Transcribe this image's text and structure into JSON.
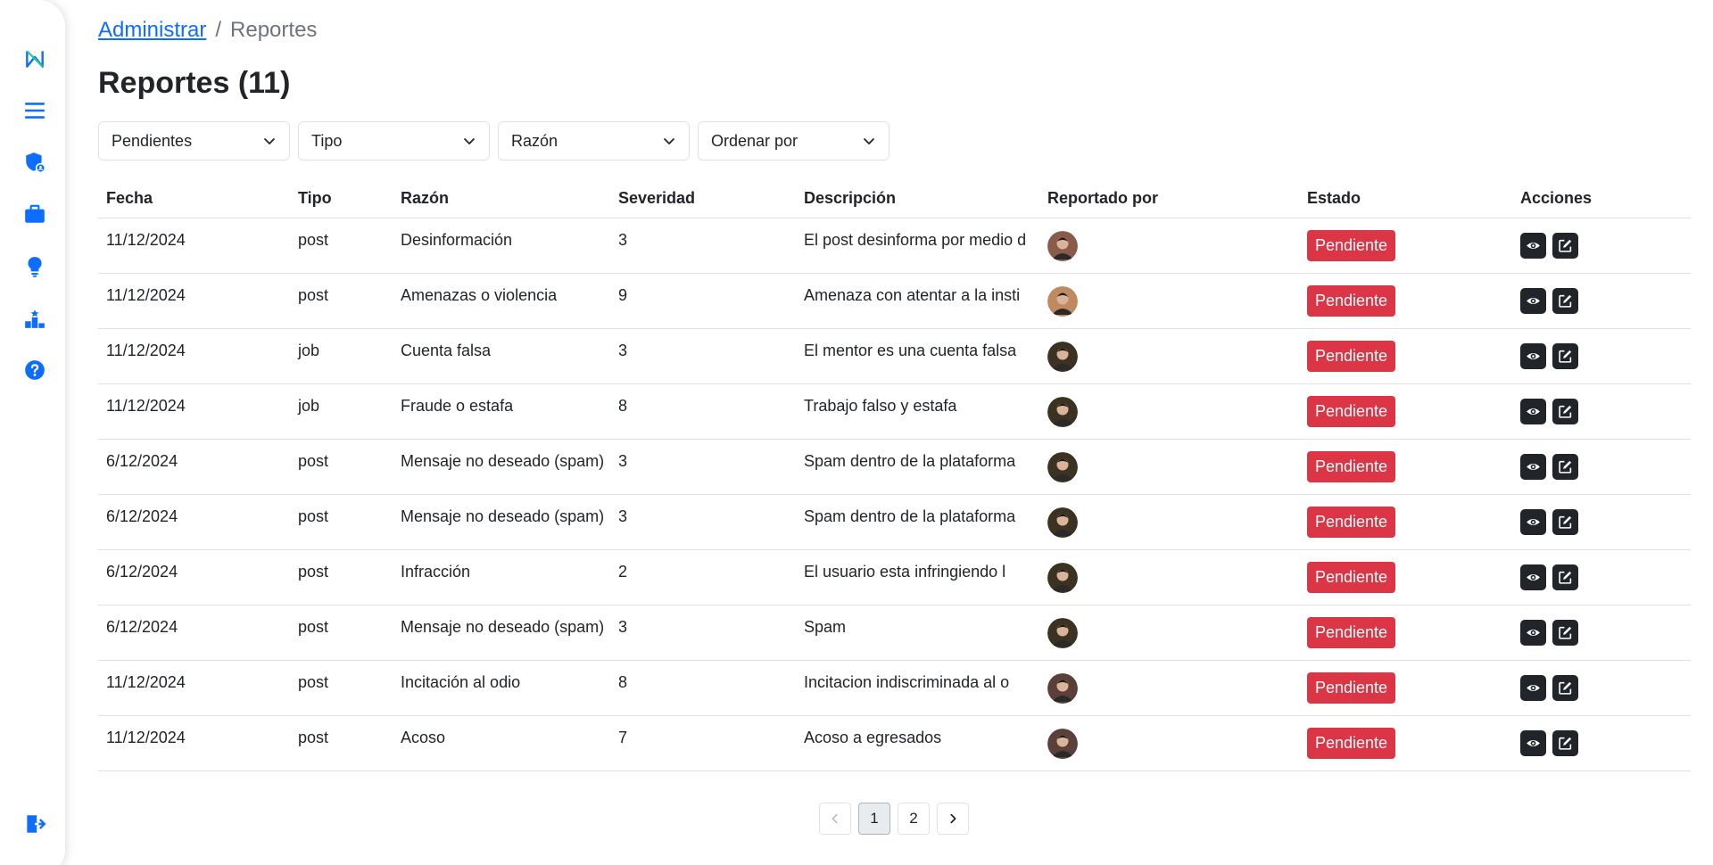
{
  "breadcrumb": {
    "parent": "Administrar",
    "separator": "/",
    "current": "Reportes"
  },
  "page_title": "Reportes (11)",
  "filters": [
    {
      "label": "Pendientes"
    },
    {
      "label": "Tipo"
    },
    {
      "label": "Razón"
    },
    {
      "label": "Ordenar por"
    }
  ],
  "table": {
    "headers": [
      "Fecha",
      "Tipo",
      "Razón",
      "Severidad",
      "Descripción",
      "Reportado por",
      "Estado",
      "Acciones"
    ],
    "rows": [
      {
        "fecha": "11/12/2024",
        "tipo": "post",
        "razon": "Desinformación",
        "severidad": "3",
        "descripcion": "El post desinforma por medio d",
        "estado": "Pendiente",
        "avatar_color": "#8a5a4a"
      },
      {
        "fecha": "11/12/2024",
        "tipo": "post",
        "razon": "Amenazas o violencia",
        "severidad": "9",
        "descripcion": "Amenaza con atentar a la insti",
        "estado": "Pendiente",
        "avatar_color": "#c08a60"
      },
      {
        "fecha": "11/12/2024",
        "tipo": "job",
        "razon": "Cuenta falsa",
        "severidad": "3",
        "descripcion": "El mentor es una cuenta falsa",
        "estado": "Pendiente",
        "avatar_color": "#3b3222"
      },
      {
        "fecha": "11/12/2024",
        "tipo": "job",
        "razon": "Fraude o estafa",
        "severidad": "8",
        "descripcion": "Trabajo falso y estafa",
        "estado": "Pendiente",
        "avatar_color": "#3b3222"
      },
      {
        "fecha": "6/12/2024",
        "tipo": "post",
        "razon": "Mensaje no deseado (spam)",
        "severidad": "3",
        "descripcion": "Spam dentro de la plataforma",
        "estado": "Pendiente",
        "avatar_color": "#3b3222"
      },
      {
        "fecha": "6/12/2024",
        "tipo": "post",
        "razon": "Mensaje no deseado (spam)",
        "severidad": "3",
        "descripcion": "Spam dentro de la plataforma",
        "estado": "Pendiente",
        "avatar_color": "#3b3222"
      },
      {
        "fecha": "6/12/2024",
        "tipo": "post",
        "razon": "Infracción",
        "severidad": "2",
        "descripcion": "El usuario esta infringiendo l",
        "estado": "Pendiente",
        "avatar_color": "#3b3222"
      },
      {
        "fecha": "6/12/2024",
        "tipo": "post",
        "razon": "Mensaje no deseado (spam)",
        "severidad": "3",
        "descripcion": "Spam",
        "estado": "Pendiente",
        "avatar_color": "#3b3222"
      },
      {
        "fecha": "11/12/2024",
        "tipo": "post",
        "razon": "Incitación al odio",
        "severidad": "8",
        "descripcion": "Incitacion indiscriminada al o",
        "estado": "Pendiente",
        "avatar_color": "#5a4038"
      },
      {
        "fecha": "11/12/2024",
        "tipo": "post",
        "razon": "Acoso",
        "severidad": "7",
        "descripcion": "Acoso a egresados",
        "estado": "Pendiente",
        "avatar_color": "#5a4038"
      }
    ]
  },
  "pagination": {
    "pages": [
      "1",
      "2"
    ],
    "current": "1"
  },
  "sidebar": {
    "icons": [
      "logo-icon",
      "menu-icon",
      "shield-user-icon",
      "briefcase-icon",
      "lightbulb-icon",
      "podium-icon",
      "help-icon",
      "logout-icon"
    ]
  },
  "colors": {
    "primary": "#0d6efd",
    "danger": "#dc3545",
    "dark": "#212529",
    "sidebar_icon": "#0d6efd"
  }
}
